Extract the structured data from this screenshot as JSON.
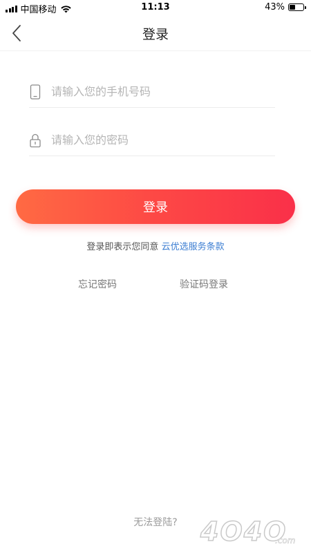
{
  "status_bar": {
    "carrier": "中国移动",
    "time": "11:13",
    "battery_percent": "43%",
    "battery_level": 0.43
  },
  "nav": {
    "title": "登录",
    "back_icon": "chevron-left-icon"
  },
  "form": {
    "phone_placeholder": "请输入您的手机号码",
    "phone_icon": "mobile-phone-icon",
    "password_placeholder": "请输入您的密码",
    "password_icon": "lock-icon"
  },
  "login_button": "登录",
  "agreement": {
    "prefix": "登录即表示您同意",
    "link": "云优选服务条款"
  },
  "options": {
    "forgot_password": "忘记密码",
    "sms_login": "验证码登录"
  },
  "cannot_login": "无法登陆?",
  "watermark": {
    "text": "4O4O",
    "suffix": ".com"
  },
  "colors": {
    "button_start": "#ff6a43",
    "button_end": "#fa3049",
    "link": "#3c7ed2"
  }
}
